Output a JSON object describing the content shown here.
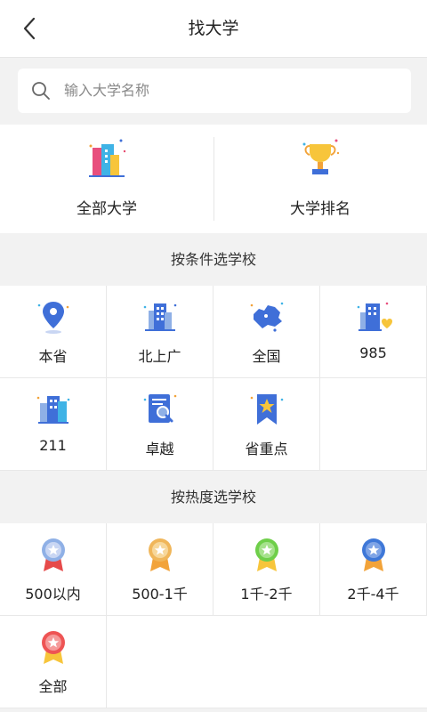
{
  "header": {
    "title": "找大学"
  },
  "search": {
    "placeholder": "输入大学名称"
  },
  "quick": [
    {
      "label": "全部大学",
      "icon": "buildings-icon"
    },
    {
      "label": "大学排名",
      "icon": "trophy-icon"
    }
  ],
  "section_condition": {
    "title": "按条件选学校"
  },
  "conditions": [
    {
      "label": "本省",
      "icon": "location-pin-icon"
    },
    {
      "label": "北上广",
      "icon": "city-building-icon"
    },
    {
      "label": "全国",
      "icon": "china-map-icon"
    },
    {
      "label": "985",
      "icon": "building-heart-icon"
    },
    {
      "label": "211",
      "icon": "office-buildings-icon"
    },
    {
      "label": "卓越",
      "icon": "document-search-icon"
    },
    {
      "label": "省重点",
      "icon": "star-bookmark-icon"
    }
  ],
  "section_heat": {
    "title": "按热度选学校"
  },
  "heat": [
    {
      "label": "500以内",
      "icon": "medal-silver-icon",
      "color": "#8fb0e6"
    },
    {
      "label": "500-1千",
      "icon": "medal-gold-icon",
      "color": "#f0b65a"
    },
    {
      "label": "1千-2千",
      "icon": "medal-green-icon",
      "color": "#6fcf4a"
    },
    {
      "label": "2千-4千",
      "icon": "medal-blue-icon",
      "color": "#3f78d8"
    },
    {
      "label": "全部",
      "icon": "medal-red-icon",
      "color": "#ee5454"
    }
  ],
  "colors": {
    "accent_blue": "#3f6fd8",
    "bg": "#f2f2f2"
  }
}
